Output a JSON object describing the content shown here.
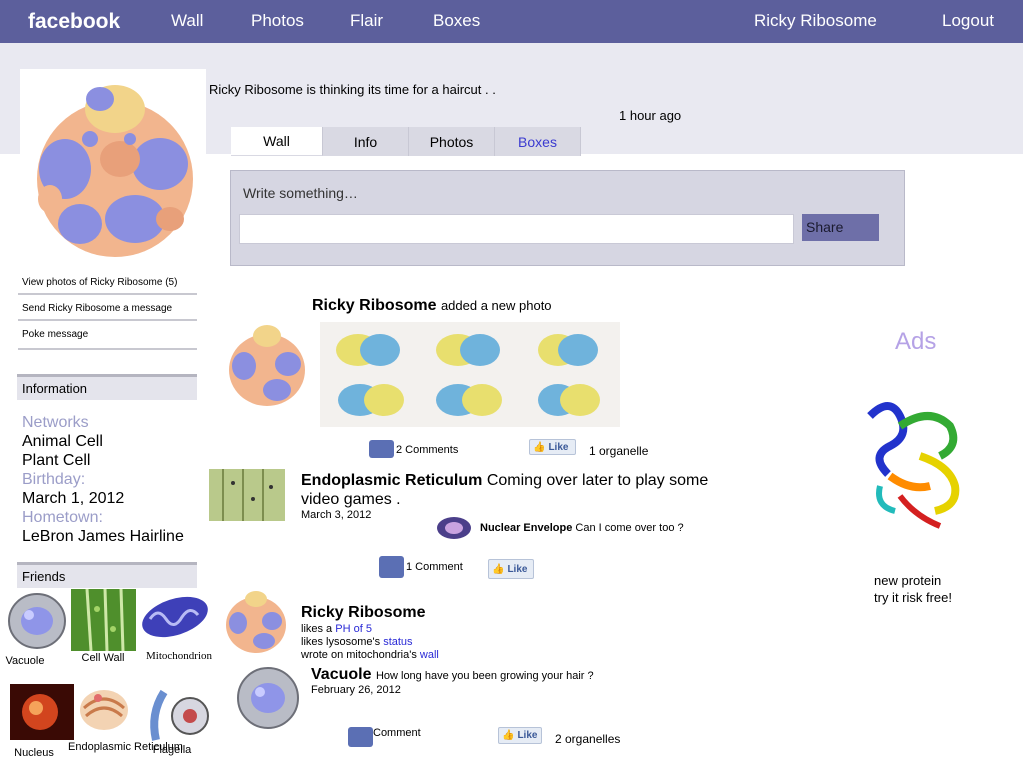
{
  "topbar": {
    "brand": "facebook",
    "nav": [
      "Wall",
      "Photos",
      "Flair",
      "Boxes"
    ],
    "user": "Ricky Ribosome",
    "logout": "Logout"
  },
  "header": {
    "status": "Ricky Ribosome is thinking its time for a haircut . .",
    "time_ago": "1 hour ago"
  },
  "tabs": [
    "Wall",
    "Info",
    "Photos",
    "Boxes"
  ],
  "composer": {
    "prompt": "Write something…",
    "share": "Share"
  },
  "sidebar": {
    "links": [
      "View photos of Ricky Ribosome (5)",
      "Send Ricky Ribosome a message",
      "Poke message"
    ],
    "information_head": "Information",
    "networks_label": "Networks",
    "networks": [
      "Animal Cell",
      "Plant Cell"
    ],
    "birthday_label": "Birthday:",
    "birthday": "March 1, 2012",
    "hometown_label": "Hometown:",
    "hometown": "LeBron James Hairline",
    "friends_head": "Friends",
    "friends": [
      "Vacuole",
      "Cell Wall",
      "Mitochondrion",
      "Nucleus",
      "Endoplasmic Reticulum",
      "Flagella"
    ]
  },
  "feed": {
    "post1": {
      "name": "Ricky Ribosome",
      "action": "added a new photo",
      "comments": "2 Comments",
      "like": "Like",
      "likes": "1 organelle"
    },
    "post2": {
      "name": "Endoplasmic Reticulum",
      "text": "Coming over later to play some video games .",
      "date": "March 3, 2012",
      "reply_name": "Nuclear Envelope",
      "reply_text": "Can I come over too ?",
      "comments": "1 Comment",
      "like": "Like"
    },
    "post3": {
      "name": "Ricky Ribosome",
      "likes_prefix": "likes a",
      "likes_link": "PH of 5",
      "line2_prefix": "likes lysosome's",
      "line2_link": "status",
      "line3_prefix": "wrote on mitochondria's",
      "line3_link": "wall"
    },
    "post4": {
      "name": "Vacuole",
      "text": "How long have you been growing your hair ?",
      "date": "February 26, 2012",
      "comments": "Comment",
      "like": "Like",
      "likes": "2 organelles"
    }
  },
  "ads": {
    "title": "Ads",
    "line1": "new protein",
    "line2": "try it risk free!"
  },
  "colors": {
    "topbar": "#5c5f9c",
    "band": "#e9e9f1",
    "label": "#9b9dc8",
    "ads": "#b5a2e6"
  }
}
